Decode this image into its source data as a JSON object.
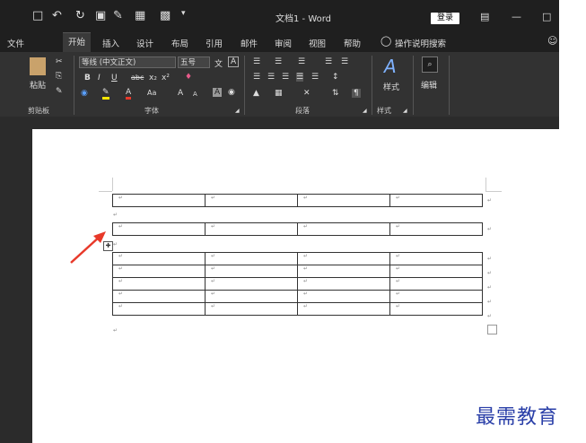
{
  "titlebar": {
    "doc_title": "文档1  -  Word",
    "login_label": "登录",
    "save_icon": "save-icon",
    "undo_glyph": "↶",
    "redo_glyph": "↻"
  },
  "tabs": [
    "文件",
    "开始",
    "插入",
    "设计",
    "布局",
    "引用",
    "邮件",
    "审阅",
    "视图",
    "帮助"
  ],
  "search_tab": "操作说明搜索",
  "ribbon": {
    "paste_label": "粘贴",
    "clipboard_label": "剪贴板",
    "font_name": "等线 (中文正文)",
    "font_size": "五号",
    "font_group_label": "字体",
    "paragraph_label": "段落",
    "styles_label": "样式",
    "styles_group_label": "样式",
    "edit_label": "编辑",
    "bold": "B",
    "italic": "I",
    "underline": "U",
    "strike": "abc",
    "sub": "x₂",
    "sup": "x²",
    "grow": "A",
    "shrink": "A",
    "aa": "Aa"
  },
  "document": {
    "para_mark": "↵",
    "table1_rows": 1,
    "table2_rows": 1,
    "table3_rows": 5,
    "cols": 4
  },
  "watermark": "最需教育",
  "colors": {
    "accent": "#e8392a",
    "dark": "#2b2b2b"
  }
}
